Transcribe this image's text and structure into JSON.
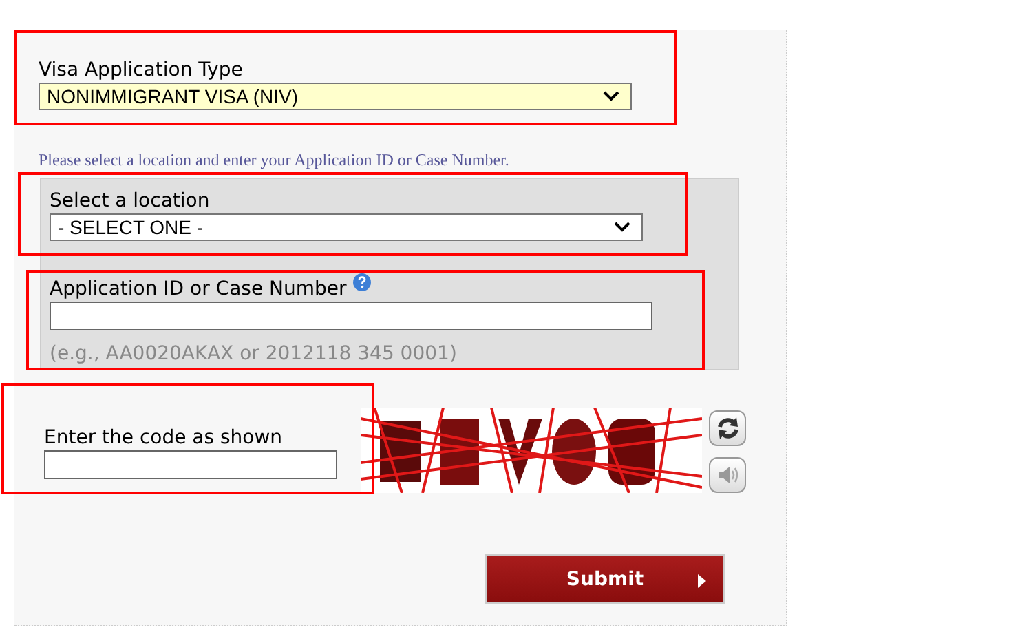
{
  "visa_type": {
    "label": "Visa Application Type",
    "value": "NONIMMIGRANT VISA (NIV)",
    "highlighted": true
  },
  "instruction": "Please select a location and enter your Application ID or Case Number.",
  "location": {
    "label": "Select a location",
    "value": "- SELECT ONE -",
    "highlighted": true
  },
  "application_id": {
    "label": "Application ID or Case Number",
    "hint": "(e.g., AA0020AKAX or 2012118 345 0001)",
    "highlighted": true
  },
  "captcha": {
    "label": "Enter the code as shown",
    "highlighted": true
  },
  "submit": {
    "label": "Submit"
  }
}
